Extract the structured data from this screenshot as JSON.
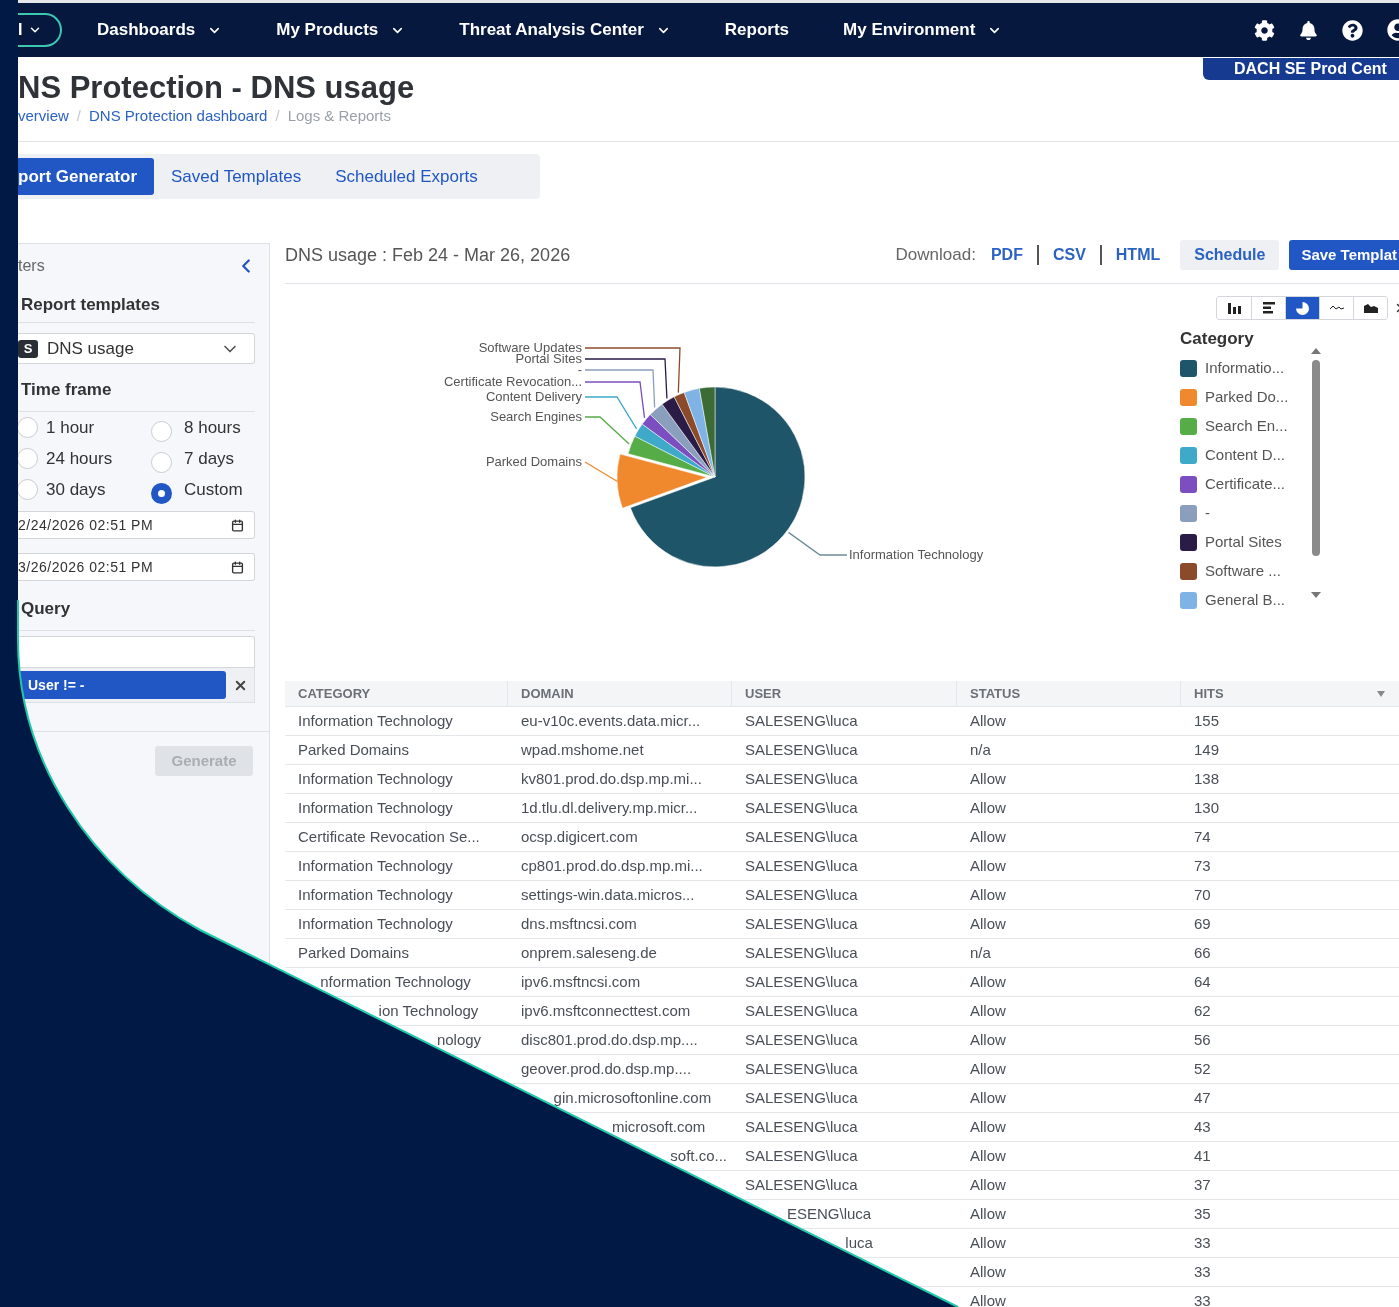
{
  "nav": {
    "scope": "I",
    "items": [
      {
        "label": "Dashboards",
        "dropdown": true
      },
      {
        "label": "My Products",
        "dropdown": true
      },
      {
        "label": "Threat Analysis Center",
        "dropdown": true
      },
      {
        "label": "Reports",
        "dropdown": false
      },
      {
        "label": "My Environment",
        "dropdown": true
      }
    ]
  },
  "tenant": "DACH SE Prod Cent",
  "page": {
    "title": "NS Protection - DNS usage",
    "separator": "/",
    "breadcrumb": [
      {
        "label": "verview",
        "link": true
      },
      {
        "label": "DNS Protection dashboard",
        "link": true
      },
      {
        "label": "Logs & Reports",
        "link": false
      }
    ]
  },
  "tabs": [
    {
      "label": "port Generator",
      "selected": true
    },
    {
      "label": "Saved Templates",
      "selected": false
    },
    {
      "label": "Scheduled Exports",
      "selected": false
    }
  ],
  "filters": {
    "title": "ters",
    "templates_heading": "Report templates",
    "template": {
      "badge": "S",
      "value": "DNS usage"
    },
    "timeframe_heading": "Time frame",
    "options": [
      {
        "label": "1 hour",
        "selected": false
      },
      {
        "label": "8 hours",
        "selected": false
      },
      {
        "label": "24 hours",
        "selected": false
      },
      {
        "label": "7 days",
        "selected": false
      },
      {
        "label": "30 days",
        "selected": false
      },
      {
        "label": "Custom",
        "selected": true
      }
    ],
    "from": "2/24/2026 02:51 PM",
    "to": "3/26/2026 02:51 PM",
    "query_heading": "Query",
    "query_chips": [
      "User != -"
    ],
    "generate": {
      "label": "Generate",
      "disabled": true
    }
  },
  "report": {
    "title": "DNS usage : Feb 24 - Mar 26, 2026",
    "download_label": "Download:",
    "formats": [
      "PDF",
      "CSV",
      "HTML"
    ],
    "schedule": "Schedule",
    "save": "Save Templat"
  },
  "chart": {
    "types": [
      {
        "kind": "bar",
        "selected": false
      },
      {
        "kind": "hbar",
        "selected": false
      },
      {
        "kind": "pie",
        "selected": true
      },
      {
        "kind": "line",
        "selected": false
      },
      {
        "kind": "area",
        "selected": false
      }
    ],
    "labels": [
      "Software Updates",
      "Portal Sites",
      "-",
      "Certificate Revocation...",
      "Content Delivery",
      "Search Engines",
      "Parked Domains",
      "Information Technology"
    ],
    "legend_title": "Category",
    "legend": [
      {
        "label": "Informatio...",
        "color": "#1f5569"
      },
      {
        "label": "Parked Do...",
        "color": "#f0892e"
      },
      {
        "label": "Search En...",
        "color": "#56ad47"
      },
      {
        "label": "Content D...",
        "color": "#3fa9c9"
      },
      {
        "label": "Certificate...",
        "color": "#7b4fc0"
      },
      {
        "label": "-",
        "color": "#8a9fbd"
      },
      {
        "label": "Portal Sites",
        "color": "#2a1b47"
      },
      {
        "label": "Software ...",
        "color": "#8b4b2a"
      },
      {
        "label": "General B...",
        "color": "#7fb3e6"
      }
    ]
  },
  "table": {
    "columns": [
      {
        "label": "CATEGORY",
        "sorted": false
      },
      {
        "label": "DOMAIN",
        "sorted": false
      },
      {
        "label": "USER",
        "sorted": false
      },
      {
        "label": "STATUS",
        "sorted": false
      },
      {
        "label": "HITS",
        "sorted": true
      }
    ],
    "rows": [
      {
        "category": "Information Technology",
        "domain": "eu-v10c.events.data.micr...",
        "user": "SALESENG\\luca",
        "status": "Allow",
        "hits": "155"
      },
      {
        "category": "Parked Domains",
        "domain": "wpad.mshome.net",
        "user": "SALESENG\\luca",
        "status": "n/a",
        "hits": "149"
      },
      {
        "category": "Information Technology",
        "domain": "kv801.prod.do.dsp.mp.mi...",
        "user": "SALESENG\\luca",
        "status": "Allow",
        "hits": "138"
      },
      {
        "category": "Information Technology",
        "domain": "1d.tlu.dl.delivery.mp.micr...",
        "user": "SALESENG\\luca",
        "status": "Allow",
        "hits": "130"
      },
      {
        "category": "Certificate Revocation Se...",
        "domain": "ocsp.digicert.com",
        "user": "SALESENG\\luca",
        "status": "Allow",
        "hits": "74"
      },
      {
        "category": "Information Technology",
        "domain": "cp801.prod.do.dsp.mp.mi...",
        "user": "SALESENG\\luca",
        "status": "Allow",
        "hits": "73"
      },
      {
        "category": "Information Technology",
        "domain": "settings-win.data.micros...",
        "user": "SALESENG\\luca",
        "status": "Allow",
        "hits": "70"
      },
      {
        "category": "Information Technology",
        "domain": "dns.msftncsi.com",
        "user": "SALESENG\\luca",
        "status": "Allow",
        "hits": "69"
      },
      {
        "category": "Parked Domains",
        "domain": "onprem.saleseng.de",
        "user": "SALESENG\\luca",
        "status": "n/a",
        "hits": "66"
      },
      {
        "category": "nformation Technology",
        "domain": "ipv6.msftncsi.com",
        "user": "SALESENG\\luca",
        "status": "Allow",
        "hits": "64"
      },
      {
        "category": "ion Technology",
        "domain": "ipv6.msftconnecttest.com",
        "user": "SALESENG\\luca",
        "status": "Allow",
        "hits": "62"
      },
      {
        "category": "nology",
        "domain": "disc801.prod.do.dsp.mp....",
        "user": "SALESENG\\luca",
        "status": "Allow",
        "hits": "56"
      },
      {
        "domain": "geover.prod.do.dsp.mp....",
        "user": "SALESENG\\luca",
        "status": "Allow",
        "hits": "52"
      },
      {
        "domain": "gin.microsoftonline.com",
        "user": "SALESENG\\luca",
        "status": "Allow",
        "hits": "47"
      },
      {
        "domain": "microsoft.com",
        "user": "SALESENG\\luca",
        "status": "Allow",
        "hits": "43"
      },
      {
        "domain": "soft.co...",
        "user": "SALESENG\\luca",
        "status": "Allow",
        "hits": "41"
      },
      {
        "user": "SALESENG\\luca",
        "status": "Allow",
        "hits": "37"
      },
      {
        "user": "ESENG\\luca",
        "status": "Allow",
        "hits": "35"
      },
      {
        "user": "luca",
        "status": "Allow",
        "hits": "33"
      },
      {
        "status": "Allow",
        "hits": "33"
      },
      {
        "status": "Allow",
        "hits": "33"
      }
    ]
  }
}
